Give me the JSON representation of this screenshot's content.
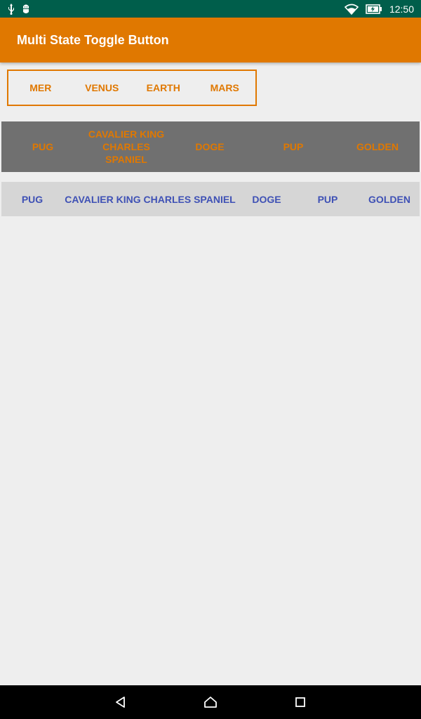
{
  "status_bar": {
    "time": "12:50",
    "icons_left": [
      "usb-icon",
      "android-debug-icon"
    ],
    "icons_right": [
      "wifi-icon",
      "battery-charging-icon"
    ]
  },
  "app_bar": {
    "title": "Multi State Toggle Button",
    "background": "#e07800"
  },
  "planet_toggle": {
    "buttons": [
      "MER",
      "VENUS",
      "EARTH",
      "MARS"
    ],
    "color": "#e07800"
  },
  "dog_toggle_dark": {
    "buttons": [
      "PUG",
      "CAVALIER KING CHARLES SPANIEL",
      "DOGE",
      "PUP",
      "GOLDEN"
    ],
    "background": "#707070",
    "text_color": "#e07800"
  },
  "dog_toggle_light": {
    "buttons": [
      "PUG",
      "CAVALIER KING CHARLES SPANIEL",
      "DOGE",
      "PUP",
      "GOLDEN"
    ],
    "background": "#d6d6d6",
    "text_color": "#3f51b5"
  },
  "nav_bar": {
    "buttons": [
      "back-icon",
      "home-icon",
      "recents-icon"
    ]
  }
}
